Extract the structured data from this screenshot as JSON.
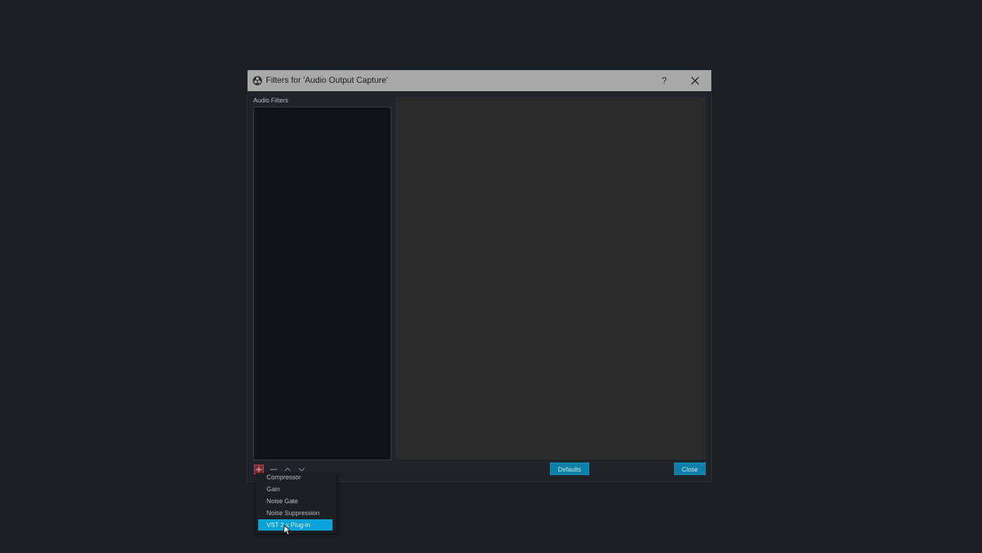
{
  "dialog": {
    "title": "Filters for 'Audio Output Capture'",
    "help_label": "?",
    "section_label": "Audio Filters",
    "icons": {
      "app": "obs-logo-icon",
      "close": "close-icon",
      "add": "plus-icon",
      "remove": "minus-icon",
      "up": "chevron-up-icon",
      "down": "chevron-down-icon"
    },
    "buttons": {
      "defaults_label": "Defaults",
      "close_label": "Close"
    }
  },
  "add_menu": {
    "items": [
      {
        "label": "Compressor"
      },
      {
        "label": "Gain"
      },
      {
        "label": "Noise Gate"
      },
      {
        "label": "Noise Suppression"
      },
      {
        "label": "VST 2.x Plug-in"
      }
    ],
    "selected_label": "VST 2.x Plug-in"
  },
  "colors": {
    "background": "#1b1e23",
    "titlebar": "#a9a9a9",
    "accent": "#0aa3d9",
    "button": "#0c7fa8",
    "add_button": "#7a2a33"
  }
}
